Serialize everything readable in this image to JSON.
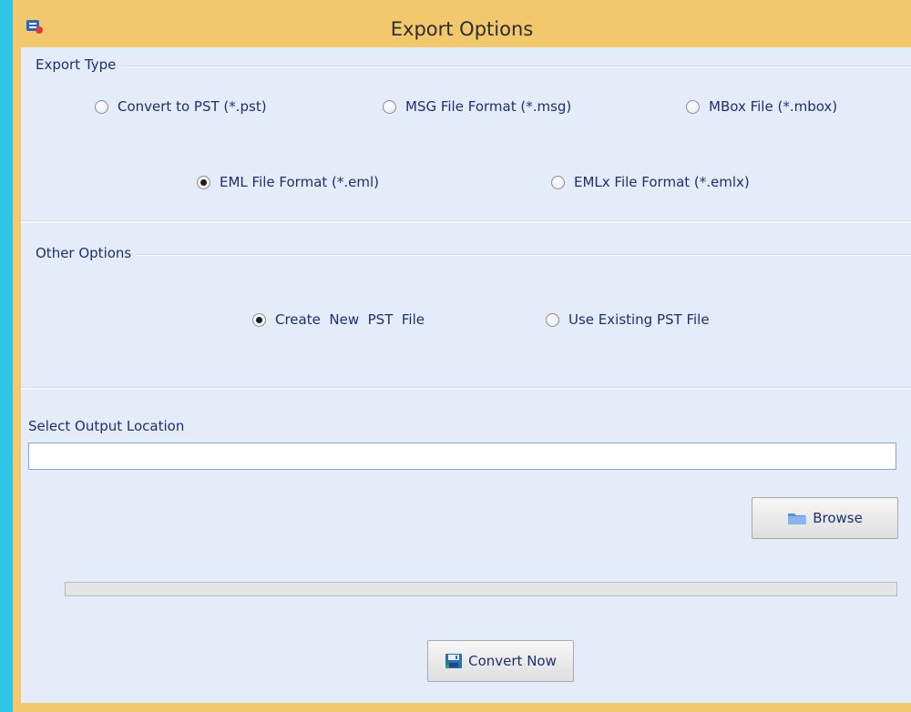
{
  "window": {
    "title": "Export Options"
  },
  "export_type": {
    "label": "Export Type",
    "options": [
      {
        "label": "Convert to PST (*.pst)",
        "checked": false
      },
      {
        "label": "MSG File Format (*.msg)",
        "checked": false
      },
      {
        "label": "MBox File (*.mbox)",
        "checked": false
      },
      {
        "label": "EML File Format (*.eml)",
        "checked": true
      },
      {
        "label": "EMLx File Format (*.emlx)",
        "checked": false
      }
    ]
  },
  "other_options": {
    "label": "Other Options",
    "options": [
      {
        "label": "Create  New  PST  File",
        "checked": true
      },
      {
        "label": "Use Existing PST File",
        "checked": false
      }
    ]
  },
  "output": {
    "label": "Select Output Location",
    "value": ""
  },
  "browse_label": "Browse",
  "progress": 0,
  "convert_label": "Convert Now",
  "icons": {
    "app": "app-logo-icon",
    "browse": "folder-icon",
    "convert": "save-icon"
  }
}
